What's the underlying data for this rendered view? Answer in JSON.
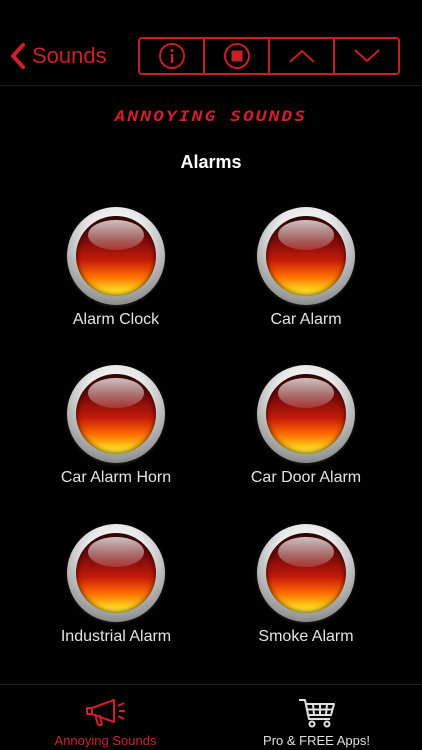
{
  "nav": {
    "back_label": "Sounds",
    "back_icon": "chevron-left-icon",
    "segments": [
      {
        "icon": "info-icon"
      },
      {
        "icon": "stop-icon"
      },
      {
        "icon": "chevron-up-icon"
      },
      {
        "icon": "chevron-down-icon"
      }
    ]
  },
  "app_logo_text": "ANNOYING SOUNDS",
  "section_title": "Alarms",
  "sounds": [
    {
      "label": "Alarm Clock"
    },
    {
      "label": "Car Alarm"
    },
    {
      "label": "Car Alarm Horn"
    },
    {
      "label": "Car Door Alarm"
    },
    {
      "label": "Industrial Alarm"
    },
    {
      "label": "Smoke Alarm"
    }
  ],
  "tabbar": {
    "tabs": [
      {
        "label": "Annoying Sounds",
        "icon": "megaphone-icon",
        "active": true
      },
      {
        "label": "Pro & FREE Apps!",
        "icon": "shopping-cart-icon",
        "active": false
      }
    ]
  },
  "colors": {
    "accent": "#d01f2a",
    "background": "#000000",
    "text": "#ffffff"
  }
}
